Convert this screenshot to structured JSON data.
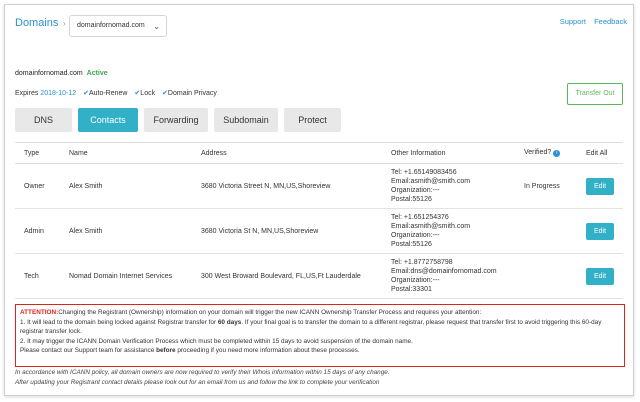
{
  "header": {
    "title": "Domains",
    "selected_domain": "domainfornomad.com",
    "links": [
      "Support",
      "Feedback"
    ]
  },
  "domain": {
    "name": "domainfornomad.com",
    "status": "Active",
    "expires_label": "Expires",
    "expires_date": "2018-10-12",
    "features": [
      "Auto-Renew",
      "Lock",
      "Domain Privacy"
    ],
    "transfer_out_label": "Transfer Out"
  },
  "tabs": [
    {
      "label": "DNS",
      "active": false
    },
    {
      "label": "Contacts",
      "active": true
    },
    {
      "label": "Forwarding",
      "active": false
    },
    {
      "label": "Subdomain",
      "active": false
    },
    {
      "label": "Protect",
      "active": false
    }
  ],
  "table": {
    "headers": {
      "type": "Type",
      "name": "Name",
      "address": "Address",
      "other": "Other Information",
      "verified": "Verified?",
      "edit_all": "Edit All"
    },
    "rows": [
      {
        "type": "Owner",
        "name": "Alex Smith",
        "address": "3680 Victoria Street N, MN,US,Shoreview",
        "tel": "Tel: +1.65149083456",
        "email": "Email:asmith@smith.com",
        "org": "Organization:---",
        "postal": "Postal:55126",
        "verified": "In Progress",
        "edit_label": "Edit"
      },
      {
        "type": "Admin",
        "name": "Alex Smith",
        "address": "3680 Victoria St N, MN,US,Shoreview",
        "tel": "Tel: +1.651254376",
        "email": "Email:asmith@smith.com",
        "org": "Organization:---",
        "postal": "Postal:55126",
        "verified": "",
        "edit_label": "Edit"
      },
      {
        "type": "Tech",
        "name": "Nomad Domain Internet Services",
        "address": "300 West Broward Boulevard, FL,US,Ft Lauderdale",
        "tel": "Tel: +1.8772758798",
        "email": "Email:dns@domainfornomad.com",
        "org": "Organization:---",
        "postal": "Postal:33301",
        "verified": "",
        "edit_label": "Edit"
      }
    ]
  },
  "attention": {
    "label": "ATTENTION:",
    "intro": "Changing the Registrant (Ownership) information on your domain will trigger the new ICANN Ownership Transfer Process and requires your attention:",
    "line1_pre": "1. It will lead to the domain being locked against Registrar transfer for ",
    "line1_bold": "60 days",
    "line1_post": ". If your final goal is to transfer the domain to a different registrar, please request that transfer first to avoid triggering this 60-day registrar transfer lock.",
    "line2": "2. It may trigger the ICANN Domain Verification Process which must be completed within 15 days to avoid suspension of the domain name.",
    "line3_pre": "Please contact our Support team for assistance ",
    "line3_bold": "before",
    "line3_post": " proceeding if you need more information about these processes."
  },
  "footnotes": [
    "In accordance with ICANN policy, all domain owners are now required to verify their Whois information within 15 days of any change.",
    "After updating your Registrant contact details please look out for an email from us and follow the link to complete your verification"
  ]
}
